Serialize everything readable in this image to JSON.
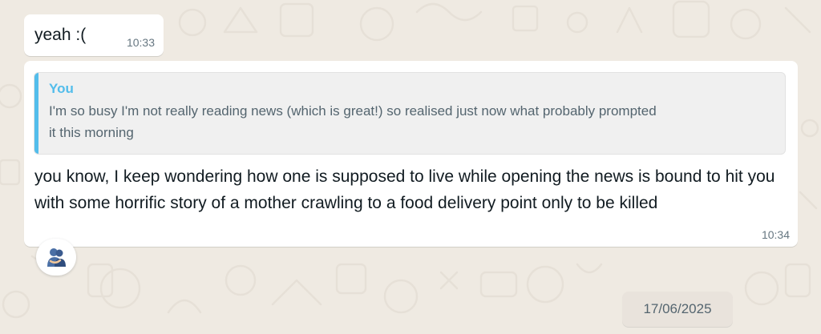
{
  "messages": [
    {
      "text": "yeah :(",
      "time": "10:33"
    },
    {
      "quote": {
        "author": "You",
        "text": "I'm so busy I'm not really reading news (which is great!) so realised just now what probably prompted it this morning"
      },
      "text": "you know, I keep wondering how one is supposed to live while opening the news is bound to hit you with some horrific story of a mother crawling to a food delivery point only to be killed",
      "time": "10:34",
      "reaction_icon": "people-hugging-icon"
    }
  ],
  "date_separator": "17/06/2025",
  "colors": {
    "background": "#efeae2",
    "bubble": "#ffffff",
    "quote_accent": "#53bdeb",
    "timestamp": "#667781"
  }
}
